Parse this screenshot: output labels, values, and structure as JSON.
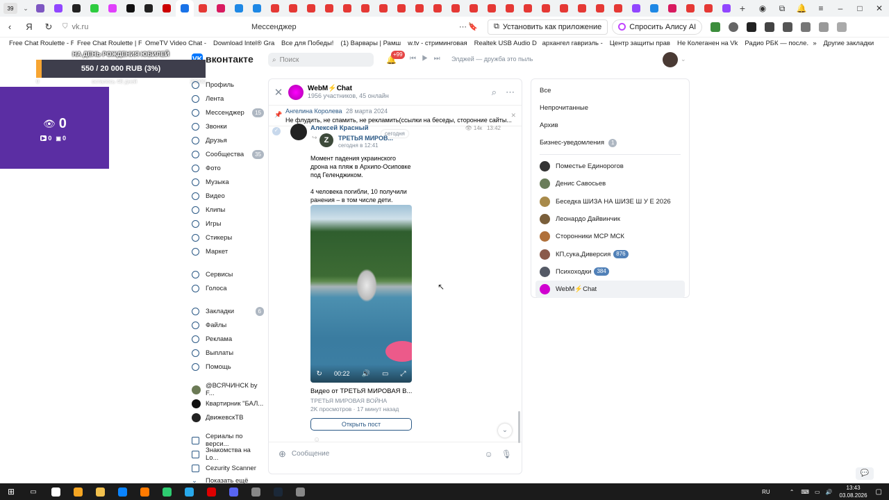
{
  "browser": {
    "tab_count": "39",
    "url": "vk.ru",
    "page_title": "Мессенджер",
    "install_label": "Установить как приложение",
    "alice_label": "Спросить Алису AI",
    "tab_colors": [
      "#7e57c2",
      "#9146ff",
      "#222",
      "#2ecc40",
      "#e040fb",
      "#111",
      "#222",
      "#c00",
      "#1a73e8",
      "#e53935",
      "#d81b60",
      "#1e88e5",
      "#1e88e5",
      "#e53935",
      "#e53935",
      "#e53935",
      "#e53935",
      "#e53935",
      "#e53935",
      "#e53935",
      "#e53935",
      "#e53935",
      "#e53935",
      "#e53935",
      "#e53935",
      "#e53935",
      "#e53935",
      "#e53935",
      "#e53935",
      "#e53935",
      "#e53935",
      "#e53935",
      "#e53935",
      "#9146ff",
      "#1e88e5",
      "#d81b60",
      "#e53935",
      "#e53935",
      "#9146ff"
    ]
  },
  "bookmarks": {
    "items": [
      "Free Chat Roulette - F",
      "Free Chat Roulette | F",
      "OmeTV Video Chat -",
      "Download Intel® Gra",
      "Все для Победы!",
      "(1) Варвары | Рамш",
      "w.tv - стриминговая",
      "Realtek USB Audio D",
      "архангел гавриэль -",
      "Центр защиты прав",
      "Не Колеганен на Vk",
      "Радио РБК — после..."
    ],
    "more_label": "»",
    "other_label": "Другие закладки"
  },
  "overlay": {
    "donate_title": "НА ДЕНЬ РОЖДЕНИЯ ЮБИЛЕЙ",
    "donate_progress": "550 / 20 000 RUB (3%)",
    "donate_fraction": 0.0275,
    "donate_min": "0",
    "donate_left": "осталось 48 дней",
    "donate_max": "20000",
    "viewers": "0",
    "sub_a": "0",
    "sub_b": "0"
  },
  "vk": {
    "logo_text": "вконтакте",
    "search_placeholder": "Поиск",
    "notif_badge": "+99",
    "track": "Элджей — дружба это пыль"
  },
  "menu": {
    "items": [
      {
        "label": "Профиль",
        "badge": ""
      },
      {
        "label": "Лента",
        "badge": ""
      },
      {
        "label": "Мессенджер",
        "badge": "15"
      },
      {
        "label": "Звонки",
        "badge": ""
      },
      {
        "label": "Друзья",
        "badge": ""
      },
      {
        "label": "Сообщества",
        "badge": "35"
      },
      {
        "label": "Фото",
        "badge": ""
      },
      {
        "label": "Музыка",
        "badge": ""
      },
      {
        "label": "Видео",
        "badge": ""
      },
      {
        "label": "Клипы",
        "badge": ""
      },
      {
        "label": "Игры",
        "badge": ""
      },
      {
        "label": "Стикеры",
        "badge": ""
      },
      {
        "label": "Маркет",
        "badge": ""
      }
    ],
    "items2": [
      {
        "label": "Сервисы",
        "badge": ""
      },
      {
        "label": "Голоса",
        "badge": ""
      }
    ],
    "items3": [
      {
        "label": "Закладки",
        "badge": "6"
      },
      {
        "label": "Файлы",
        "badge": ""
      },
      {
        "label": "Реклама",
        "badge": ""
      },
      {
        "label": "Выплаты",
        "badge": ""
      },
      {
        "label": "Помощь",
        "badge": ""
      }
    ],
    "communities": [
      {
        "label": "@ВСЯЧИНСК by F...",
        "color": "#6b7a55"
      },
      {
        "label": "Квартирник \"БАЛ...",
        "color": "#111"
      },
      {
        "label": "ДвижевскТВ",
        "color": "#222"
      }
    ],
    "apps": [
      "Сериалы по верси...",
      "Знакомства на Lo...",
      "Cezurity Scanner"
    ],
    "show_more": "Показать ещё"
  },
  "chat": {
    "title": "WebM⚡Chat",
    "subtitle": "1956 участников, 45 онлайн",
    "pinned_author": "Ангелина Королева",
    "pinned_date": "28 марта 2024",
    "pinned_text": "Не флудить, не спамить, не рекламить(ссылки на беседы, сторонние сайты...",
    "msg_author": "Алексей Красный",
    "msg_time": "13:42",
    "msg_views": "14к",
    "today_chip": "сегодня",
    "forward_name": "ТРЕТЬЯ МИРОВ...",
    "forward_time": "сегодня в 12:41",
    "post_text_1": "Момент падения украинского дрона на пляж в Архипо-Осиповке под Геленджиком.",
    "post_text_2": "4 человека погибли, 10 получили ранения – в том числе дети.",
    "video_time": "00:22",
    "video_title": "Видео от ТРЕТЬЯ МИРОВАЯ В...",
    "video_channel": "ТРЕТЬЯ МИРОВАЯ ВОЙНА",
    "video_meta": "2K просмотров · 17 минут назад",
    "open_post": "Открыть пост",
    "compose_placeholder": "Сообщение"
  },
  "filters": {
    "tabs": [
      {
        "label": "Все",
        "badge": ""
      },
      {
        "label": "Непрочитанные",
        "badge": ""
      },
      {
        "label": "Архив",
        "badge": ""
      },
      {
        "label": "Бизнес-уведомления",
        "badge": "1"
      }
    ],
    "conversations": [
      {
        "label": "Поместье Единорогов",
        "badge": "",
        "color": "#333"
      },
      {
        "label": "Денис Савосьев",
        "badge": "",
        "color": "#6a7d5a"
      },
      {
        "label": "Беседка ШИЗА НА ШИЗЕ Ш У Е 2026",
        "badge": "",
        "color": "#a88a4a"
      },
      {
        "label": "Леонардо Дайвинчик",
        "badge": "",
        "color": "#7a5f3a"
      },
      {
        "label": "Сторонники МСР МСК",
        "badge": "",
        "color": "#b0703a"
      },
      {
        "label": "КП,сука,Диверсия",
        "badge": "876",
        "color": "#8a5a4a"
      },
      {
        "label": "Психоходки",
        "badge": "384",
        "color": "#555a66"
      },
      {
        "label": "WebM⚡Chat",
        "badge": "",
        "color": "#d000d0"
      }
    ]
  },
  "taskbar": {
    "icon_colors": [
      "#fff",
      "#f5a623",
      "#f2c14e",
      "#0a84ff",
      "#ff7a00",
      "#2ecc71",
      "#29a9eb",
      "#d00",
      "#5865f2",
      "#888",
      "#1b2838",
      "#888"
    ],
    "lang": "RU",
    "time": "13:43",
    "date": "03.08.2026"
  }
}
